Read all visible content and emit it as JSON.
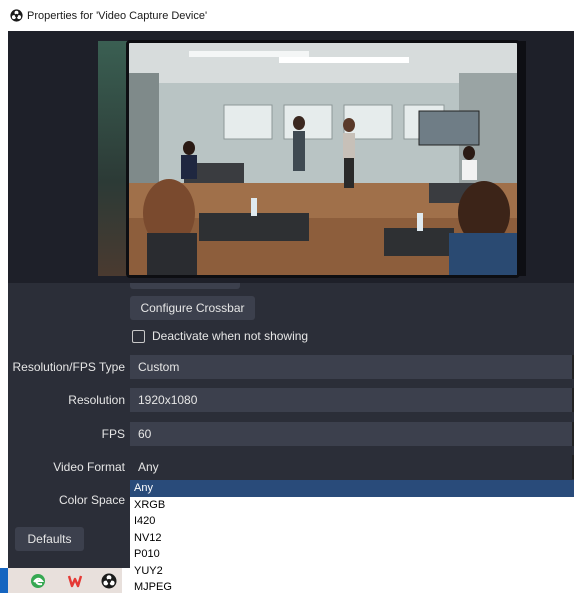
{
  "window": {
    "title": "Properties for 'Video Capture Device'",
    "app_icon": "obs-icon"
  },
  "preview": {
    "description_icon": "video-preview"
  },
  "buttons": {
    "configure_crossbar": "Configure Crossbar",
    "defaults": "Defaults"
  },
  "checkbox": {
    "deactivate_label": "Deactivate when not showing",
    "checked": false
  },
  "form": {
    "resolution_fps_type": {
      "label": "Resolution/FPS Type",
      "value": "Custom"
    },
    "resolution": {
      "label": "Resolution",
      "value": "1920x1080"
    },
    "fps": {
      "label": "FPS",
      "value": "60"
    },
    "video_format": {
      "label": "Video Format",
      "value": "Any"
    },
    "color_space": {
      "label": "Color Space"
    }
  },
  "video_format_options": [
    "Any",
    "XRGB",
    "I420",
    "NV12",
    "P010",
    "YUY2",
    "MJPEG"
  ],
  "selected_format_index": 0,
  "taskbar": {
    "icons": [
      "edge-icon",
      "wps-office-icon",
      "obs-icon"
    ]
  },
  "colors": {
    "window_bg": "#2b2e38",
    "field_bg": "#3c404d",
    "selection": "#294b7a",
    "text": "#e6e6e6"
  }
}
